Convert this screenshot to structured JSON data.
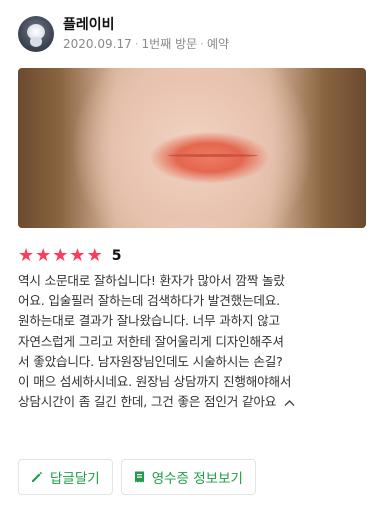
{
  "user": {
    "name": "플레이비",
    "date": "2020.09.17",
    "visit": "1번째 방문",
    "type": "예약"
  },
  "rating": {
    "stars": 5,
    "value": "5"
  },
  "review": {
    "lines": [
      "역시 소문대로 잘하십니다! 환자가 많아서 깜짝 놀랐",
      "어요. 입술필러 잘하는데 검색하다가 발견했는데요.",
      "원하는대로 결과가 잘나왔습니다. 너무 과하지 않고",
      "자연스럽게 그리고 저한테 잘어울리게 디자인해주셔",
      "서 좋았습니다. 남자원장님인데도 시술하시는 손길?",
      "이 매으 섬세하시네요. 원장님 상담까지 진행해야해서",
      "상담시간이 좀 길긴 한데, 그건 좋은 점인거 같아요"
    ]
  },
  "actions": {
    "reply_label": "답글달기",
    "receipt_label": "영수증 정보보기"
  },
  "colors": {
    "star": "#ff3b5c",
    "accent": "#1e9e4a"
  },
  "icons": {
    "collapse": "chevron-up-icon",
    "reply": "pencil-icon",
    "receipt": "receipt-icon"
  }
}
